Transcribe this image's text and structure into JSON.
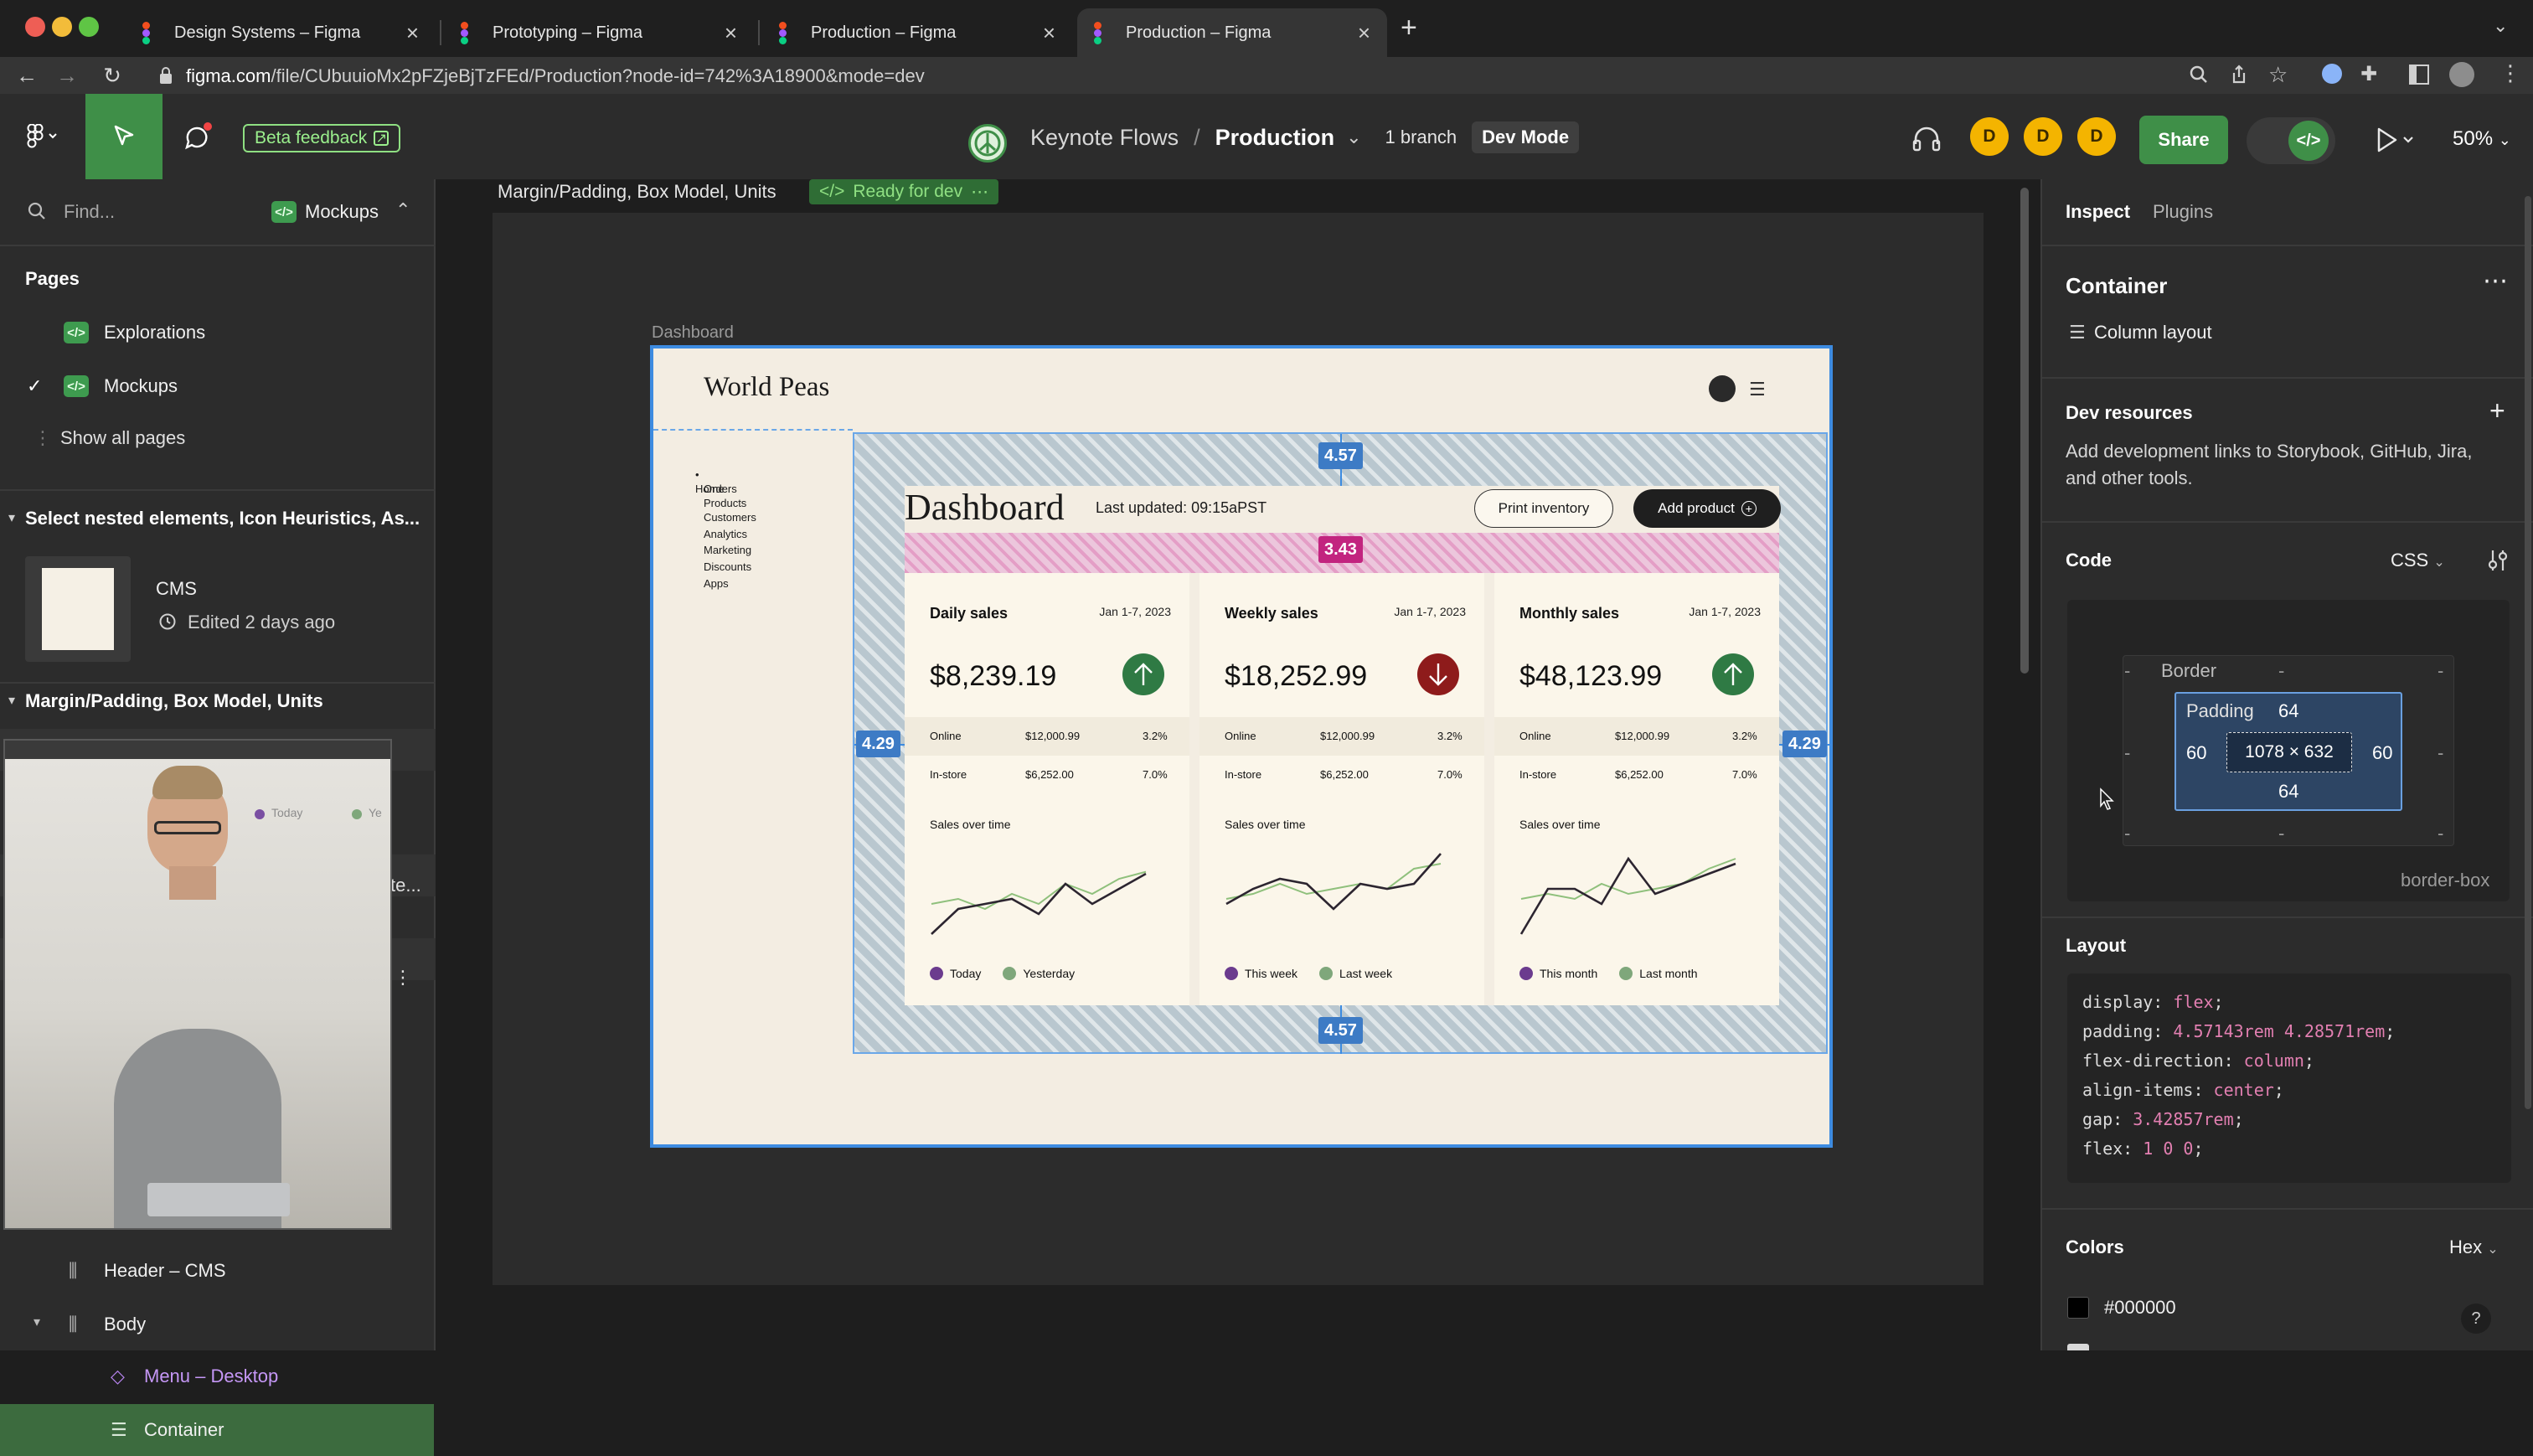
{
  "browser": {
    "tabs": [
      {
        "title": "Design Systems – Figma",
        "active": false
      },
      {
        "title": "Prototyping – Figma",
        "active": false
      },
      {
        "title": "Production – Figma",
        "active": false
      },
      {
        "title": "Production – Figma",
        "active": true
      }
    ],
    "url_host": "figma.com",
    "url_path": "/file/CUbuuioMx2pFZjeBjTzFEd/Production?node-id=742%3A18900&mode=dev"
  },
  "toolbar": {
    "beta_feedback": "Beta feedback",
    "project": "Keynote Flows",
    "separator": "/",
    "file": "Production",
    "branches": "1 branch",
    "mode": "Dev Mode",
    "avatars": [
      "D",
      "D",
      "D"
    ],
    "share": "Share",
    "zoom": "50%"
  },
  "left_panel": {
    "search_placeholder": "Find...",
    "page_selector": "Mockups",
    "pages_heading": "Pages",
    "pages": [
      {
        "name": "Explorations",
        "checked": false
      },
      {
        "name": "Mockups",
        "checked": true
      }
    ],
    "show_all_pages": "Show all pages",
    "section1_title": "Select nested elements, Icon Heuristics, As...",
    "cms_name": "CMS",
    "cms_edited": "Edited 2 days ago",
    "section2_title": "Margin/Padding, Box Model, Units",
    "video_partial_text": "te...",
    "video_legend": [
      "Today",
      "Ye"
    ],
    "layers": [
      {
        "name": "Header – CMS",
        "icon": "column-layout-icon"
      },
      {
        "name": "Body",
        "icon": "column-layout-icon"
      },
      {
        "name": "Menu – Desktop",
        "icon": "component-instance-icon"
      },
      {
        "name": "Container",
        "icon": "rows-layout-icon",
        "selected": true
      }
    ]
  },
  "canvas": {
    "section_label": "Margin/Padding, Box Model, Units",
    "ready_badge": "Ready for dev",
    "frame_label": "Dashboard",
    "brand": "World Peas",
    "nav": [
      "Home",
      "Orders",
      "Products",
      "Customers",
      "Analytics",
      "Marketing",
      "Discounts",
      "Apps"
    ],
    "dashboard_title": "Dashboard",
    "last_updated": "Last updated: 09:15aPST",
    "print_button": "Print inventory",
    "add_button": "Add product",
    "measures": {
      "top": "4.57",
      "bottom": "4.57",
      "left": "4.29",
      "right": "4.29",
      "gap": "3.43"
    },
    "cards": [
      {
        "title": "Daily sales",
        "date": "Jan 1-7, 2023",
        "amount": "$8,239.19",
        "trend": "up",
        "online_label": "Online",
        "online_value": "$12,000.99",
        "online_pct": "3.2%",
        "instore_label": "In-store",
        "instore_value": "$6,252.00",
        "instore_pct": "7.0%",
        "chart_label": "Sales over time",
        "legend": [
          "Today",
          "Yesterday"
        ],
        "primary": [
          0.1,
          0.35,
          0.4,
          0.45,
          0.3,
          0.6,
          0.4,
          0.55,
          0.7
        ],
        "secondary": [
          0.4,
          0.45,
          0.35,
          0.5,
          0.4,
          0.6,
          0.5,
          0.65,
          0.72
        ]
      },
      {
        "title": "Weekly sales",
        "date": "Jan 1-7, 2023",
        "amount": "$18,252.99",
        "trend": "down",
        "online_label": "Online",
        "online_value": "$12,000.99",
        "online_pct": "3.2%",
        "instore_label": "In-store",
        "instore_value": "$6,252.00",
        "instore_pct": "7.0%",
        "chart_label": "Sales over time",
        "legend": [
          "This week",
          "Last week"
        ],
        "primary": [
          0.4,
          0.55,
          0.65,
          0.6,
          0.35,
          0.6,
          0.55,
          0.6,
          0.9
        ],
        "secondary": [
          0.45,
          0.5,
          0.6,
          0.5,
          0.55,
          0.6,
          0.55,
          0.75,
          0.8
        ]
      },
      {
        "title": "Monthly sales",
        "date": "Jan 1-7, 2023",
        "amount": "$48,123.99",
        "trend": "up",
        "online_label": "Online",
        "online_value": "$12,000.99",
        "online_pct": "3.2%",
        "instore_label": "In-store",
        "instore_value": "$6,252.00",
        "instore_pct": "7.0%",
        "chart_label": "Sales over time",
        "legend": [
          "This month",
          "Last month"
        ],
        "primary": [
          0.1,
          0.55,
          0.55,
          0.4,
          0.85,
          0.5,
          0.6,
          0.7,
          0.8
        ],
        "secondary": [
          0.45,
          0.5,
          0.45,
          0.6,
          0.5,
          0.55,
          0.6,
          0.75,
          0.85
        ]
      }
    ]
  },
  "right_panel": {
    "tabs": [
      "Inspect",
      "Plugins"
    ],
    "layer_name": "Container",
    "layer_type": "Column layout",
    "dev_resources_title": "Dev resources",
    "dev_resources_desc_1": "Add development links to Storybook, GitHub, Jira,",
    "dev_resources_desc_2": "and other tools.",
    "code_title": "Code",
    "code_lang": "CSS",
    "box_model": {
      "border_label": "Border",
      "padding_label": "Padding",
      "padding_top": "64",
      "padding_bottom": "64",
      "padding_left": "60",
      "padding_right": "60",
      "size": "1078 × 632",
      "dash": "-",
      "box_sizing": "border-box"
    },
    "layout_title": "Layout",
    "layout_css": [
      {
        "prop": "display",
        "value": "flex"
      },
      {
        "prop": "padding",
        "value": "4.57143rem 4.28571rem"
      },
      {
        "prop": "flex-direction",
        "value": "column"
      },
      {
        "prop": "align-items",
        "value": "center"
      },
      {
        "prop": "gap",
        "value": "3.42857rem"
      },
      {
        "prop": "flex",
        "value": "1 0 0"
      }
    ],
    "colors_title": "Colors",
    "colors_format": "Hex",
    "color_swatch": "#000000",
    "help": "?"
  },
  "colors": {
    "accent_green": "#3f8f48",
    "selection_blue": "#3d8be0",
    "gap_pink": "#d0298b",
    "chart_primary": "#2c2530",
    "chart_secondary": "#8fc07c",
    "legend_primary": "#6b3b8e",
    "legend_secondary": "#7fa77b",
    "trend_up": "#2f7a44",
    "trend_down": "#8e1b1b"
  }
}
